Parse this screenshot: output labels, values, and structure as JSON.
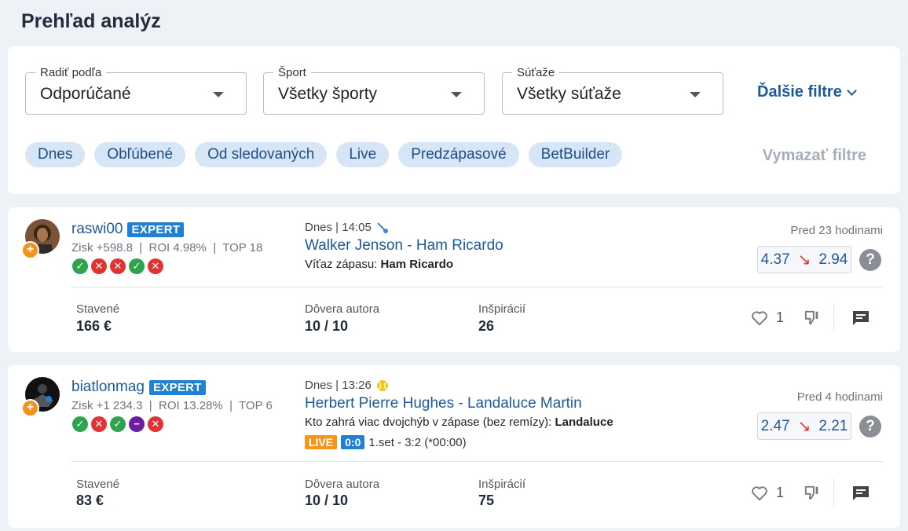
{
  "page": {
    "title": "Prehľad analýz"
  },
  "filters": {
    "sort": {
      "legend": "Radiť podľa",
      "value": "Odporúčané"
    },
    "sport": {
      "legend": "Šport",
      "value": "Všetky športy"
    },
    "competitions": {
      "legend": "Súťaže",
      "value": "Všetky súťaže"
    },
    "more": "Ďalšie filtre",
    "chips": [
      "Dnes",
      "Obľúbené",
      "Od sledovaných",
      "Live",
      "Predzápasové",
      "BetBuilder"
    ],
    "clear": "Vymazať filtre"
  },
  "labels": {
    "placed": "Stavené",
    "confidence": "Dôvera autora",
    "inspirations": "Inšpirácií"
  },
  "cards": [
    {
      "username": "raswi00",
      "badge": "EXPERT",
      "stats": "Zisk +598.8  |  ROI 4.98%  |  TOP 18",
      "results": [
        "win",
        "lose",
        "lose",
        "win",
        "lose"
      ],
      "time": "Dnes | 14:05",
      "sport_icon": "badminton-icon",
      "match": "Walker Jenson - Ham Ricardo",
      "pick_label": "Víťaz zápasu:",
      "pick_value": "Ham Ricardo",
      "posted": "Pred 23 hodinami",
      "odds_from": "4.37",
      "odds_to": "2.94",
      "placed": "166 €",
      "confidence": "10 / 10",
      "inspirations": "26",
      "likes": "1"
    },
    {
      "username": "biatlonmag",
      "badge": "EXPERT",
      "stats": "Zisk +1 234.3  |  ROI 13.28%  |  TOP 6",
      "results": [
        "win",
        "lose",
        "win",
        "void",
        "lose"
      ],
      "time": "Dnes | 13:26",
      "sport_icon": "tennis-ball-icon",
      "match": "Herbert Pierre Hughes - Landaluce Martin",
      "pick_label": "Kto zahrá viac dvojchýb v zápase (bez remízy):",
      "pick_value": "Landaluce",
      "live": "LIVE",
      "score": "0:0",
      "live_status": "1.set - 3:2 (*00:00)",
      "posted": "Pred 4 hodinami",
      "odds_from": "2.47",
      "odds_to": "2.21",
      "placed": "83 €",
      "confidence": "10 / 10",
      "inspirations": "75",
      "likes": "1"
    }
  ],
  "colors": {
    "accent": "#1e5a99",
    "win": "#2ea44f",
    "lose": "#e03434",
    "live": "#f7941d"
  }
}
